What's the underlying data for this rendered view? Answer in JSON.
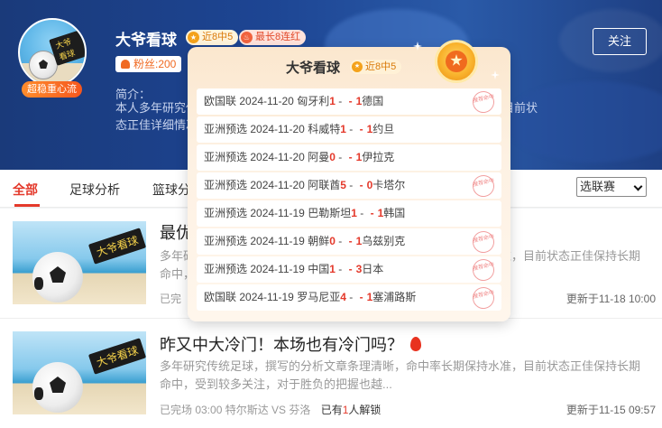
{
  "colors": {
    "accent_red": "#e4392b",
    "header_blue": "#1d4593",
    "badge_orange": "#f06a22"
  },
  "header": {
    "avatar_tag": "大爷看球",
    "super_badge": "超稳重心流",
    "name": "大爷看球",
    "chip_recent": "近8中5",
    "chip_streak": "最长8连红",
    "chip_recent_icon": "star-icon",
    "chip_streak_icon": "fire-icon",
    "fans": "粉丝:200",
    "intro_label": "简介：",
    "intro_text": "本人多年研究传统足球，撰写的分析文章条理清晰，命中率长期保持水准，目前状态正佳详细情况！对于胜负的把握很精准，请期友们多多关注！",
    "follow_button": "关注"
  },
  "tabs": {
    "items": [
      "全部",
      "足球分析",
      "篮球分析"
    ],
    "active_index": 0,
    "league_select": "选联赛"
  },
  "articles": [
    {
      "thumb_tag": "大爷看球",
      "title": "最优",
      "summary": "多年研究传统足球，撰写的分析文章条理清晰，命中率长期保持水准，目前状态正佳保持长期命中，受到较多关注，对于胜负的把握也越...",
      "meta_status": "已完",
      "updated": "更新于11-18 10:00"
    },
    {
      "thumb_tag": "大爷看球",
      "title": "昨又中大冷门！本场也有冷门吗？",
      "summary": "多年研究传统足球，撰写的分析文章条理清晰，命中率长期保持水准，目前状态正佳保持长期命中，受到较多关注，对于胜负的把握也越...",
      "meta_status": "已完场 03:00 特尔斯达 VS 芬洛",
      "meta_prefix": "已有",
      "meta_count": "1",
      "meta_suffix": "人解锁",
      "updated": "更新于11-15 09:57"
    }
  ],
  "popup": {
    "title": "大爷看球",
    "chip": "近8中5",
    "chip_icon": "star-icon",
    "stamp_text": "推荐命中",
    "matches": [
      {
        "league": "欧国联",
        "date": "2024-11-20",
        "home": "匈牙利",
        "home_score": "1",
        "away_score": "1",
        "away": "德国",
        "stamp": true
      },
      {
        "league": "亚洲预选",
        "date": "2024-11-20",
        "home": "科威特",
        "home_score": "1",
        "away_score": "1",
        "away": "约旦",
        "stamp": false
      },
      {
        "league": "亚洲预选",
        "date": "2024-11-20",
        "home": "阿曼",
        "home_score": "0",
        "away_score": "1",
        "away": "伊拉克",
        "stamp": false
      },
      {
        "league": "亚洲预选",
        "date": "2024-11-20",
        "home": "阿联酋",
        "home_score": "5",
        "away_score": "0",
        "away": "卡塔尔",
        "stamp": true
      },
      {
        "league": "亚洲预选",
        "date": "2024-11-19",
        "home": "巴勒斯坦",
        "home_score": "1",
        "away_score": "1",
        "away": "韩国",
        "stamp": false
      },
      {
        "league": "亚洲预选",
        "date": "2024-11-19",
        "home": "朝鲜",
        "home_score": "0",
        "away_score": "1",
        "away": "乌兹别克",
        "stamp": true
      },
      {
        "league": "亚洲预选",
        "date": "2024-11-19",
        "home": "中国",
        "home_score": "1",
        "away_score": "3",
        "away": "日本",
        "stamp": true
      },
      {
        "league": "欧国联",
        "date": "2024-11-19",
        "home": "罗马尼亚",
        "home_score": "4",
        "away_score": "1",
        "away": "塞浦路斯",
        "stamp": true
      }
    ]
  }
}
